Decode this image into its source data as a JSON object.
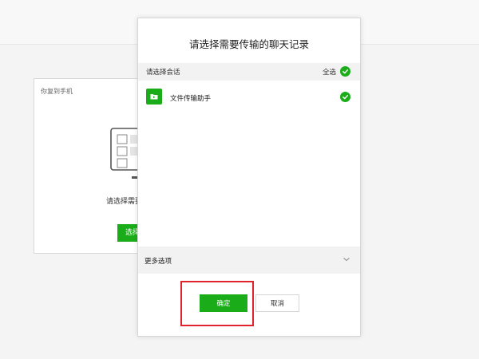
{
  "background_window": {
    "title": "你复到手机",
    "prompt": "请选择需要",
    "button_label": "选择"
  },
  "dialog": {
    "title": "请选择需要传输的聊天记录",
    "section_label": "请选择会话",
    "select_all_label": "全选",
    "chats": [
      {
        "name": "文件传输助手",
        "selected": true
      }
    ],
    "more_options_label": "更多选项",
    "confirm_label": "确定",
    "cancel_label": "取消"
  },
  "colors": {
    "accent": "#1aad19",
    "highlight": "#e0222c"
  },
  "icons": {
    "check": "check-icon",
    "folder": "folder-icon",
    "chevron": "chevron-down-icon",
    "monitor": "monitor-icon"
  }
}
